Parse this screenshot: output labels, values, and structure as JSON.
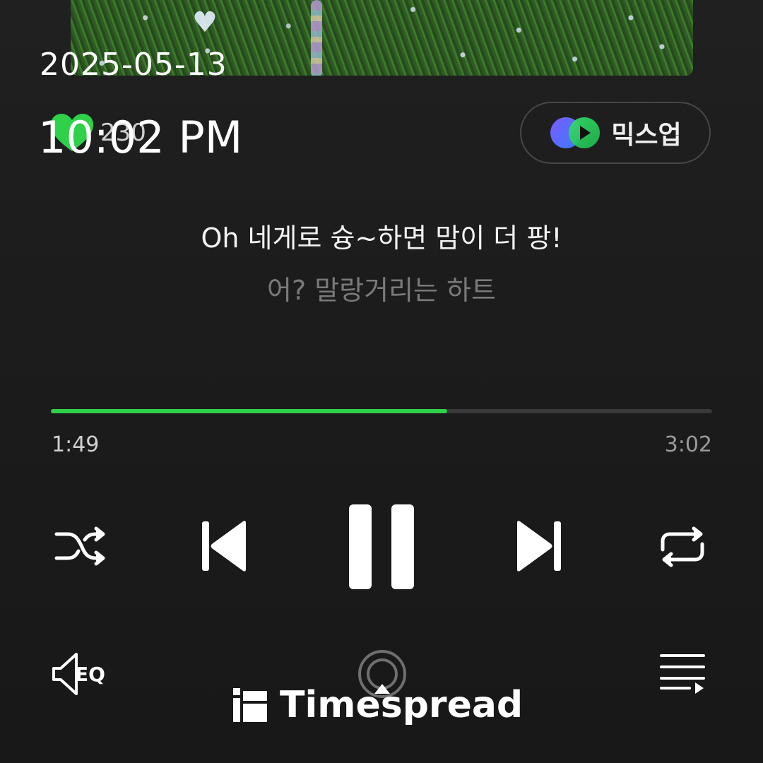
{
  "overlay": {
    "date": "2025-05-13",
    "time": "10:02 PM"
  },
  "track": {
    "like_count": "230",
    "mixup_label": "믹스업"
  },
  "lyrics": {
    "current": "Oh 네게로 슝~하면 맘이 더 팡!",
    "next": "어? 말랑거리는 하트"
  },
  "playback": {
    "elapsed": "1:49",
    "total": "3:02",
    "progress_fraction": 0.599
  },
  "controls": {
    "shuffle": "shuffle-icon",
    "previous": "skip-previous-icon",
    "pause": "pause-icon",
    "next": "skip-next-icon",
    "repeat": "repeat-icon",
    "eq": "eq-icon",
    "cast": "cast-icon",
    "playlist": "playlist-icon"
  },
  "watermark": {
    "text": "Timespread"
  },
  "colors": {
    "accent": "#2fd14a",
    "background": "#1c1c1c",
    "text_primary": "#f2f2f2",
    "text_secondary": "#7a7a7a"
  }
}
